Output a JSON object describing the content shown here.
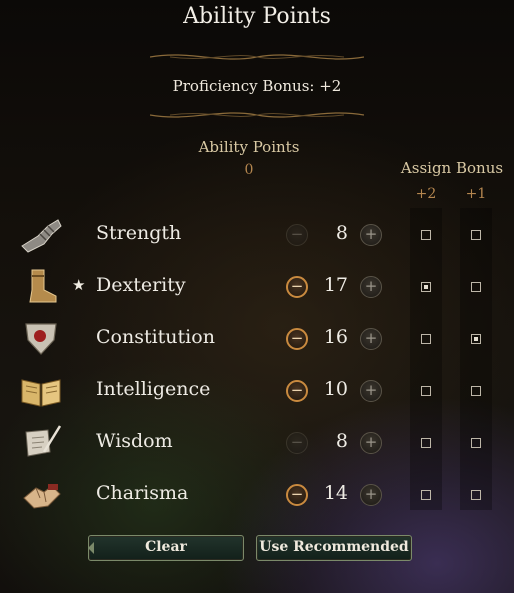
{
  "title": "Ability Points",
  "proficiency_bonus": "Proficiency Bonus: +2",
  "ability_points": {
    "label": "Ability Points",
    "value": "0"
  },
  "assign_bonus": {
    "label": "Assign Bonus",
    "col_plus2": "+2",
    "col_plus1": "+1"
  },
  "abilities": [
    {
      "name": "Strength",
      "score": "8",
      "starred": false,
      "icon": "gauntlet-icon",
      "minus_enabled": false,
      "bonus_plus2": false,
      "bonus_plus1": false
    },
    {
      "name": "Dexterity",
      "score": "17",
      "starred": true,
      "icon": "boot-icon",
      "minus_enabled": true,
      "bonus_plus2": true,
      "bonus_plus1": false
    },
    {
      "name": "Constitution",
      "score": "16",
      "starred": false,
      "icon": "shield-icon",
      "minus_enabled": true,
      "bonus_plus2": false,
      "bonus_plus1": true
    },
    {
      "name": "Intelligence",
      "score": "10",
      "starred": false,
      "icon": "open-book-icon",
      "minus_enabled": true,
      "bonus_plus2": false,
      "bonus_plus1": false
    },
    {
      "name": "Wisdom",
      "score": "8",
      "starred": false,
      "icon": "scroll-quill-icon",
      "minus_enabled": false,
      "bonus_plus2": false,
      "bonus_plus1": false
    },
    {
      "name": "Charisma",
      "score": "14",
      "starred": false,
      "icon": "hands-icon",
      "minus_enabled": true,
      "bonus_plus2": false,
      "bonus_plus1": false
    }
  ],
  "star_glyph": "★",
  "minus_glyph": "−",
  "plus_glyph": "+",
  "buttons": {
    "clear": "Clear",
    "use_recommended": "Use Recommended"
  },
  "colors": {
    "accent": "#c98a3f",
    "value_orange": "#b4864f",
    "button_green": "#1a2a22"
  }
}
